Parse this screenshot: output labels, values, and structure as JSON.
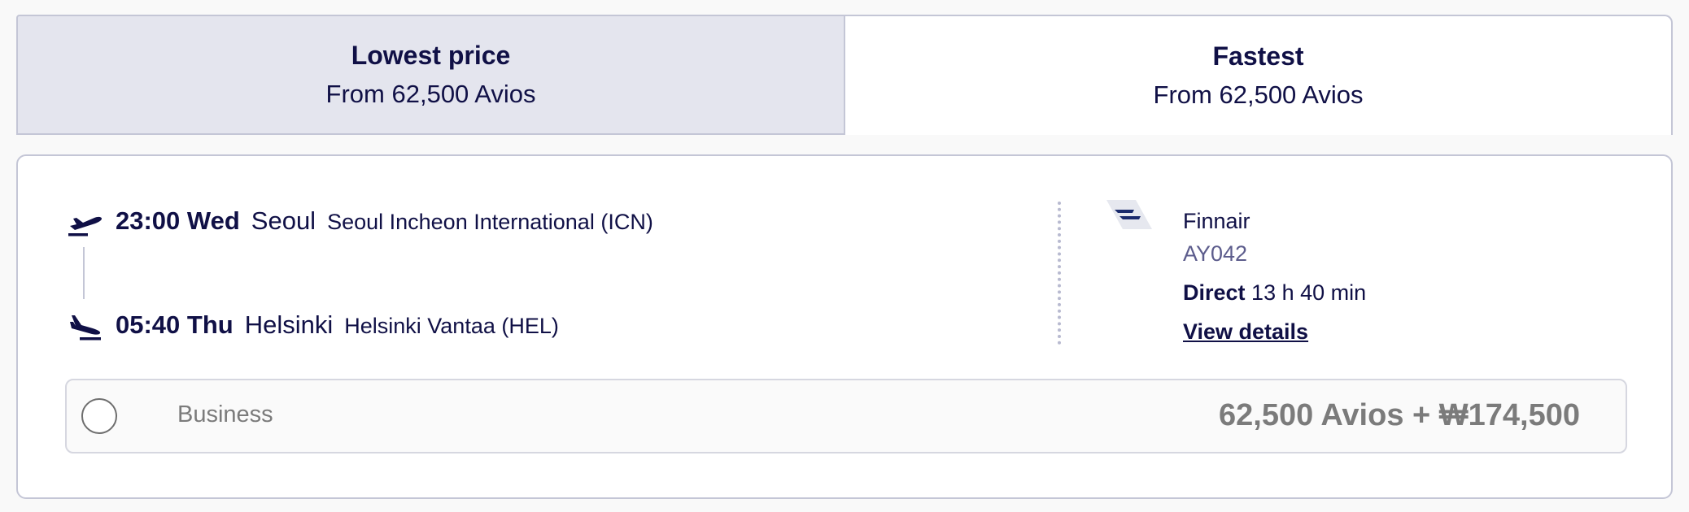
{
  "tabs": [
    {
      "title": "Lowest price",
      "subtitle": "From 62,500 Avios",
      "selected": true
    },
    {
      "title": "Fastest",
      "subtitle": "From 62,500 Avios",
      "selected": false
    }
  ],
  "flight": {
    "departure": {
      "time": "23:00 Wed",
      "city": "Seoul",
      "airport": "Seoul Incheon International (ICN)",
      "icon": "takeoff-icon"
    },
    "arrival": {
      "time": "05:40 Thu",
      "city": "Helsinki",
      "airport": "Helsinki Vantaa (HEL)",
      "icon": "landing-icon"
    },
    "airline": {
      "name": "Finnair",
      "flight_number": "AY042",
      "logo": "finnair-logo"
    },
    "stops": "Direct",
    "duration": "13 h 40 min",
    "details_label": "View details"
  },
  "fare": {
    "cabin": "Business",
    "price": "62,500 Avios + ₩174,500",
    "selected": false
  },
  "colors": {
    "text": "#101046",
    "selected_tab_bg": "#e4e5ee",
    "border": "#c4c6d6",
    "muted": "#7b7b7b",
    "flight_number": "#5c5c8c"
  }
}
